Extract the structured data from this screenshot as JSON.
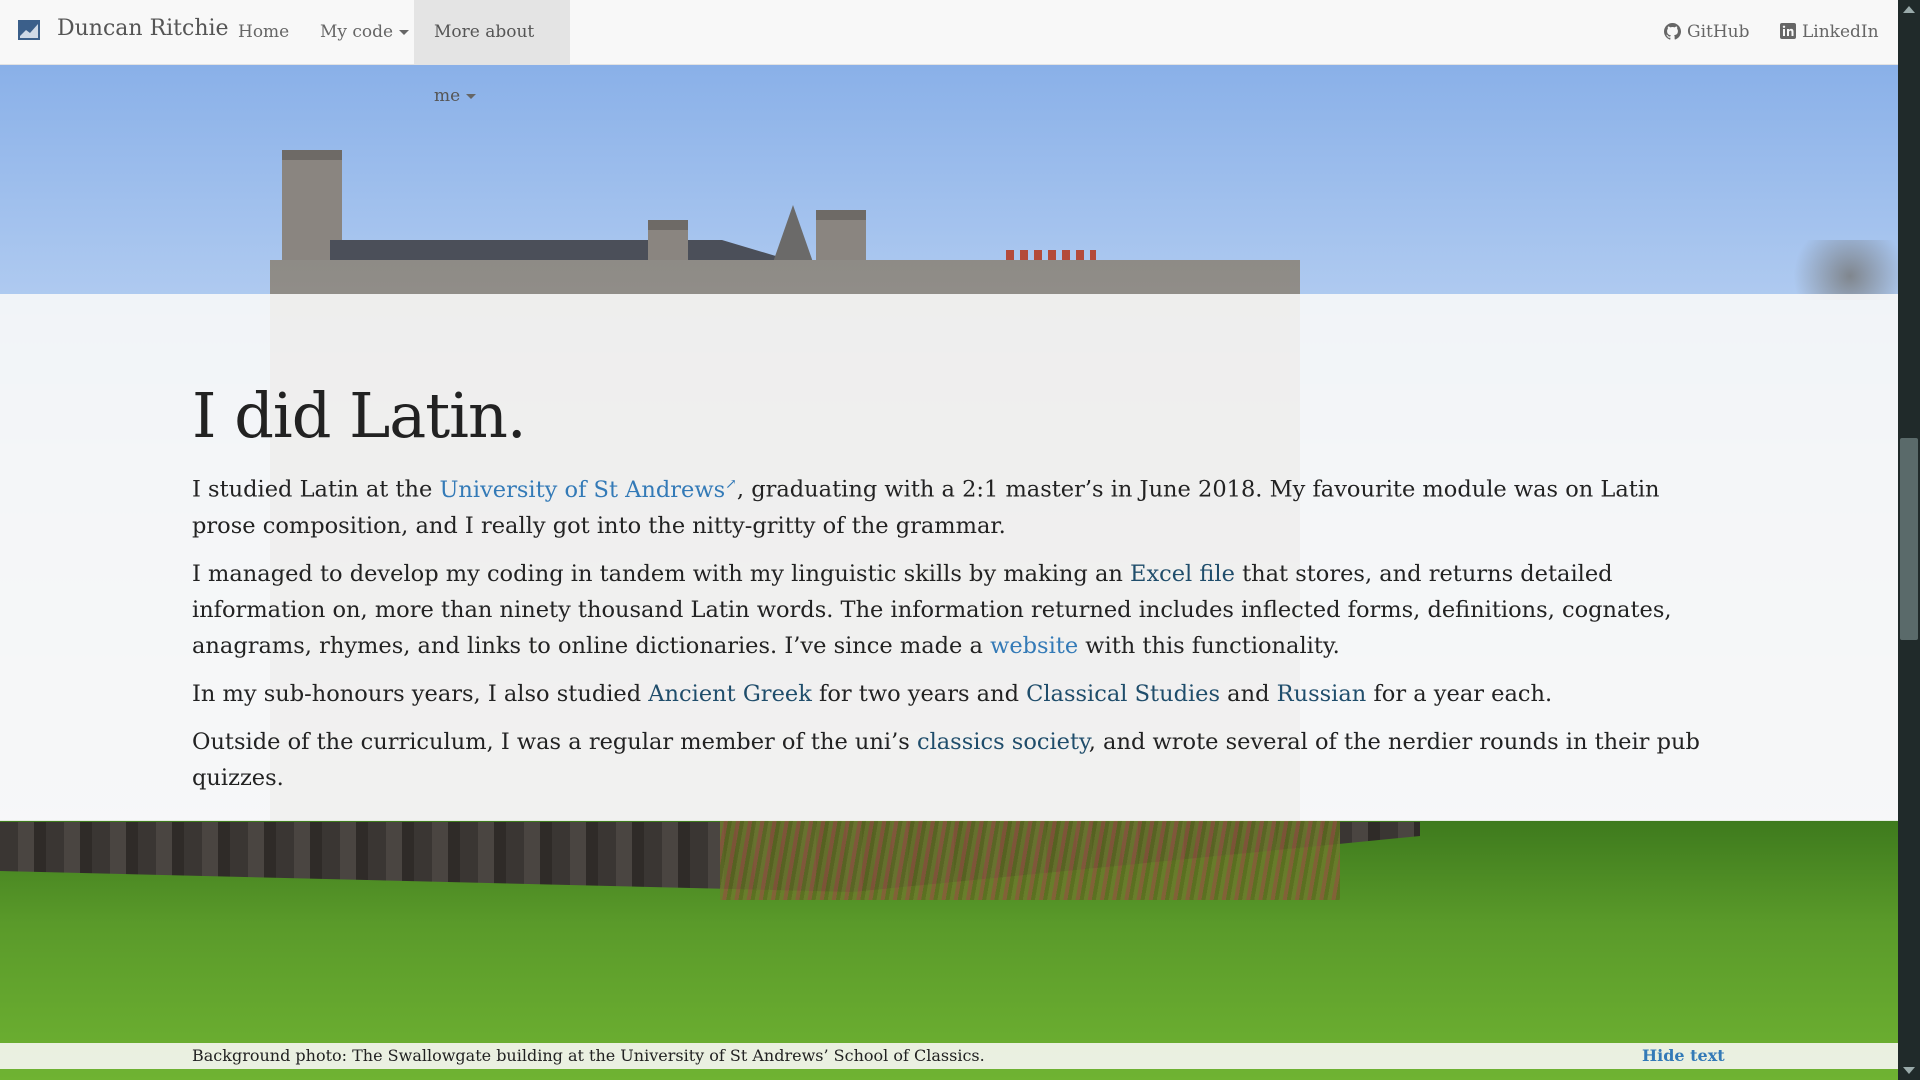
{
  "navbar": {
    "brand": "Duncan Ritchie",
    "items": [
      {
        "label": "Home"
      },
      {
        "label": "My code"
      },
      {
        "label": "More about me"
      }
    ],
    "right": [
      {
        "label": "GitHub",
        "icon": "github-icon"
      },
      {
        "label": "LinkedIn",
        "icon": "linkedin-icon"
      }
    ]
  },
  "main": {
    "heading": "I did Latin.",
    "p1": {
      "t1": "I studied Latin at the ",
      "link": "University of St Andrews",
      "ext": "↗",
      "t2": ", graduating with a 2:1 master’s in June 2018. My favourite module was on Latin prose composition, and I really got into the nitty-gritty of the grammar."
    },
    "p2": {
      "t1": "I managed to develop my coding in tandem with my linguistic skills by making an ",
      "link_excel": "Excel file",
      "t2": " that stores, and returns detailed information on, more than ninety thousand Latin words. The information returned includes inflected forms, definitions, cognates, anagrams, rhymes, and links to online dictionaries. I’ve since made a ",
      "link_website": "website",
      "t3": " with this functionality."
    },
    "p3": {
      "t1": "In my sub-honours years, I also studied ",
      "link_greek": "Ancient Greek",
      "t2": " for two years and ",
      "link_classical": "Classical Studies",
      "t3": " and ",
      "link_russian": "Russian",
      "t4": " for a year each."
    },
    "p4": {
      "t1": "Outside of the curriculum, I was a regular member of the uni’s ",
      "link_society": "classics society",
      "t2": ", and wrote several of the nerdier rounds in their pub quizzes."
    }
  },
  "footer": {
    "caption": "Background photo: The Swallowgate building at the University of St Andrews’ School of Classics.",
    "hide_label": "Hide text"
  },
  "colors": {
    "link": "#337ab7",
    "navbar_bg": "#f8f8f8",
    "active_nav_bg": "#e4e4e4"
  }
}
